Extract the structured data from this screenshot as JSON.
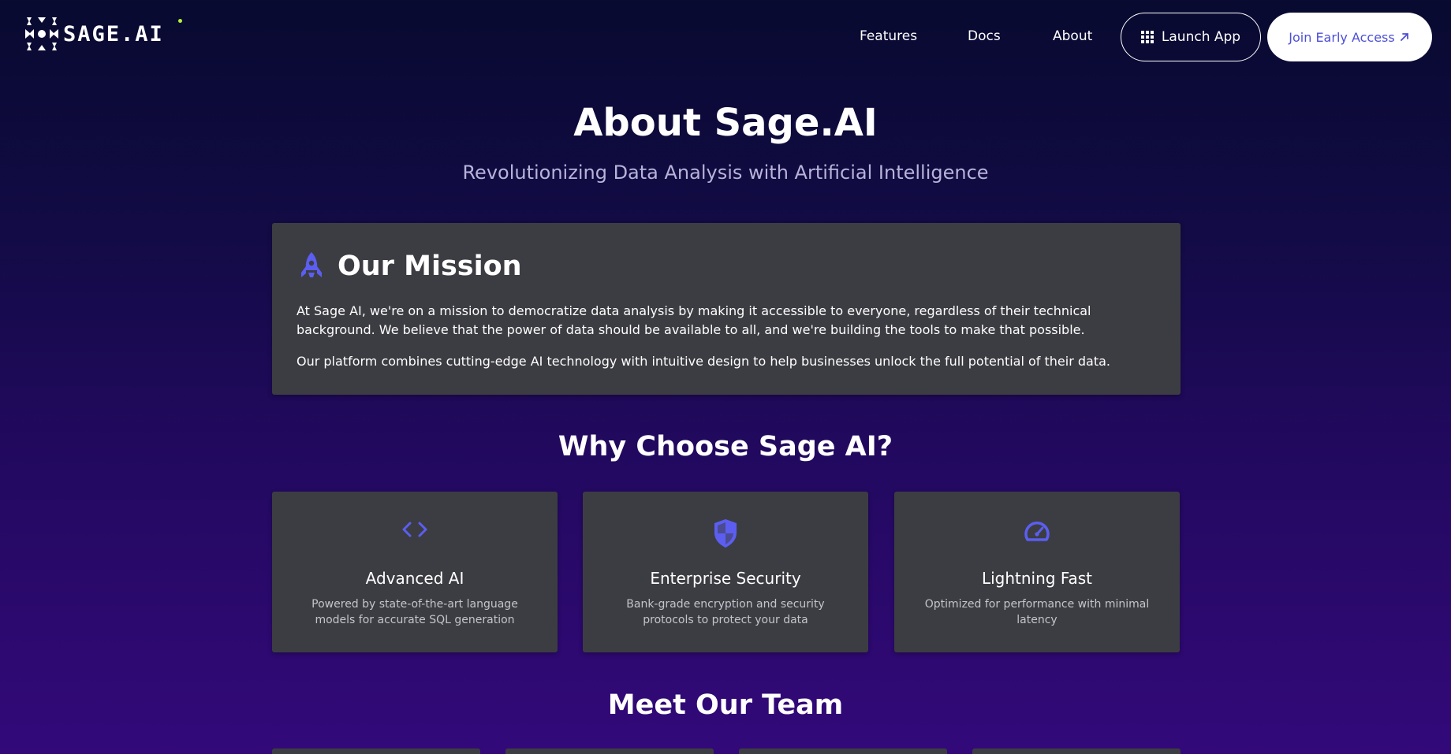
{
  "brand": {
    "name": "SAGE.AI"
  },
  "nav": {
    "links": [
      {
        "label": "Features"
      },
      {
        "label": "Docs"
      },
      {
        "label": "About"
      }
    ],
    "launch_label": "Launch App",
    "join_label": "Join Early Access"
  },
  "hero": {
    "title": "About Sage.AI",
    "subtitle": "Revolutionizing Data Analysis with Artificial Intelligence"
  },
  "mission": {
    "title": "Our Mission",
    "paragraph1": "At Sage AI, we're on a mission to democratize data analysis by making it accessible to everyone, regardless of their technical background. We believe that the power of data should be available to all, and we're building the tools to make that possible.",
    "paragraph2": "Our platform combines cutting-edge AI technology with intuitive design to help businesses unlock the full potential of their data."
  },
  "why": {
    "title": "Why Choose Sage AI?",
    "features": [
      {
        "icon": "code-icon",
        "title": "Advanced AI",
        "description": "Powered by state-of-the-art language models for accurate SQL generation"
      },
      {
        "icon": "shield-icon",
        "title": "Enterprise Security",
        "description": "Bank-grade encryption and security protocols to protect your data"
      },
      {
        "icon": "speedometer-icon",
        "title": "Lightning Fast",
        "description": "Optimized for performance with minimal latency"
      }
    ]
  },
  "team": {
    "title": "Meet Our Team"
  },
  "colors": {
    "accent": "#5b5ef0",
    "card": "#3c3d42",
    "background_top": "#080a30",
    "background_bottom": "#33097a",
    "logo_dot": "#b6f03c"
  }
}
